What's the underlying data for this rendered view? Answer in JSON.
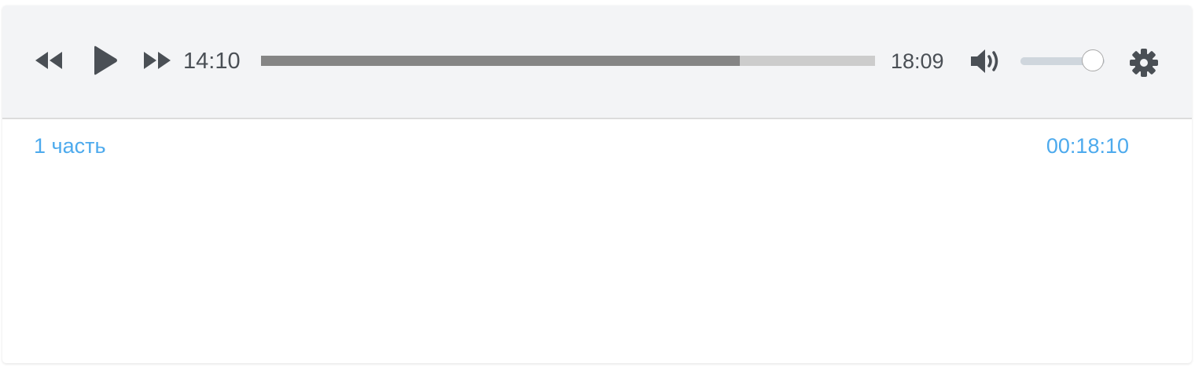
{
  "player": {
    "current_time": "14:10",
    "duration": "18:09",
    "progress_fraction": 0.78,
    "volume_fraction": 0.86,
    "icons": {
      "rewind": "rewind-icon",
      "play": "play-icon",
      "fast_forward": "fast-forward-icon",
      "volume": "volume-icon",
      "settings": "gear-icon"
    },
    "colors": {
      "icon": "#4a4f55",
      "progress_played": "#858585",
      "progress_remaining": "#cccccc",
      "link": "#4daaed",
      "controls_background": "#f3f4f6"
    }
  },
  "playlist": {
    "items": [
      {
        "title": "1 часть",
        "duration": "00:18:10"
      }
    ]
  }
}
